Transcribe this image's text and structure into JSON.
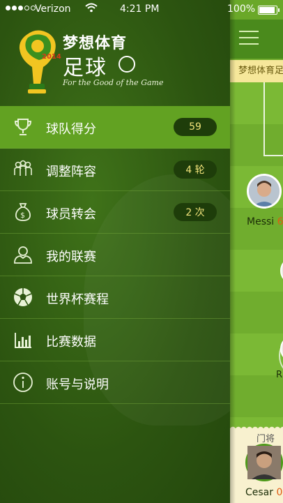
{
  "status_bar": {
    "carrier": "Verizon",
    "time": "4:21 PM",
    "battery": "100%",
    "battery_level": 1.0,
    "signal_bars_filled": 3,
    "signal_bars_total": 5
  },
  "brand": {
    "title": "梦想体育",
    "subtitle": "足球",
    "tagline": "For the Good of the Game",
    "logo_year": "2014"
  },
  "menu": {
    "items": [
      {
        "label": "球队得分",
        "badge": "59",
        "icon": "trophy-icon",
        "active": true
      },
      {
        "label": "调整阵容",
        "badge": "4 轮",
        "icon": "team-icon",
        "active": false
      },
      {
        "label": "球员转会",
        "badge": "2 次",
        "icon": "money-bag-icon",
        "active": false
      },
      {
        "label": "我的联赛",
        "badge": "",
        "icon": "user-icon",
        "active": false
      },
      {
        "label": "世界杯赛程",
        "badge": "",
        "icon": "soccer-ball-icon",
        "active": false
      },
      {
        "label": "比赛数据",
        "badge": "",
        "icon": "bar-chart-icon",
        "active": false
      },
      {
        "label": "账号与说明",
        "badge": "",
        "icon": "info-icon",
        "active": false
      }
    ]
  },
  "content": {
    "info_text": "梦想体育足",
    "players": [
      {
        "name": "Messi",
        "points": "6"
      }
    ],
    "partial_labels": [
      "R"
    ],
    "goalkeeper": {
      "role": "门将",
      "name": "Cesar",
      "points": "0"
    }
  },
  "colors": {
    "drawer_bg": "#2c5410",
    "active_item": "#62a222",
    "badge_bg": "#1e3d0a",
    "badge_text": "#f1e37a",
    "pitch": "#7bb935",
    "points": "#e05a12"
  }
}
